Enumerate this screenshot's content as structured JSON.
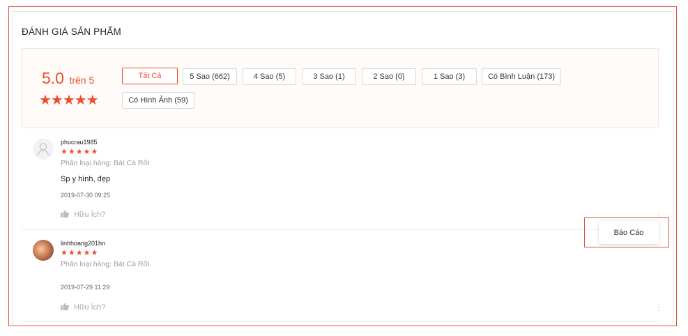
{
  "section": {
    "title": "ĐÁNH GIÁ SẢN PHẨM"
  },
  "overview": {
    "score": "5.0",
    "score_suffix": "trên 5",
    "stars": "★★★★★"
  },
  "filters": [
    {
      "label": "Tất Cả",
      "active": true
    },
    {
      "label": "5 Sao (662)"
    },
    {
      "label": "4 Sao (5)"
    },
    {
      "label": "3 Sao (1)"
    },
    {
      "label": "2 Sao (0)"
    },
    {
      "label": "1 Sao (3)"
    },
    {
      "label": "Có Bình Luận (173)"
    },
    {
      "label": "Có Hình Ảnh (59)"
    }
  ],
  "reviews": [
    {
      "username": "phucrau1985",
      "stars": "★★★★★",
      "variation": "Phân loại hàng: Bát Cà Rốt",
      "comment": "Sp y hình, đẹp",
      "timestamp": "2019-07-30 09:25",
      "helpful": "Hữu Ích?",
      "avatar_icon": "default-user-icon"
    },
    {
      "username": "linhhoang201hn",
      "stars": "★★★★★",
      "variation": "Phân loại hàng: Bát Cà Rốt",
      "comment": "",
      "timestamp": "2019-07-29 11:29",
      "helpful": "Hữu Ích?",
      "avatar_icon": "user-photo"
    }
  ],
  "context_menu": {
    "report_label": "Báo Cáo"
  },
  "colors": {
    "accent": "#ee4d2d",
    "highlight_frame": "#e0533c",
    "overview_bg": "#fffbf8"
  }
}
